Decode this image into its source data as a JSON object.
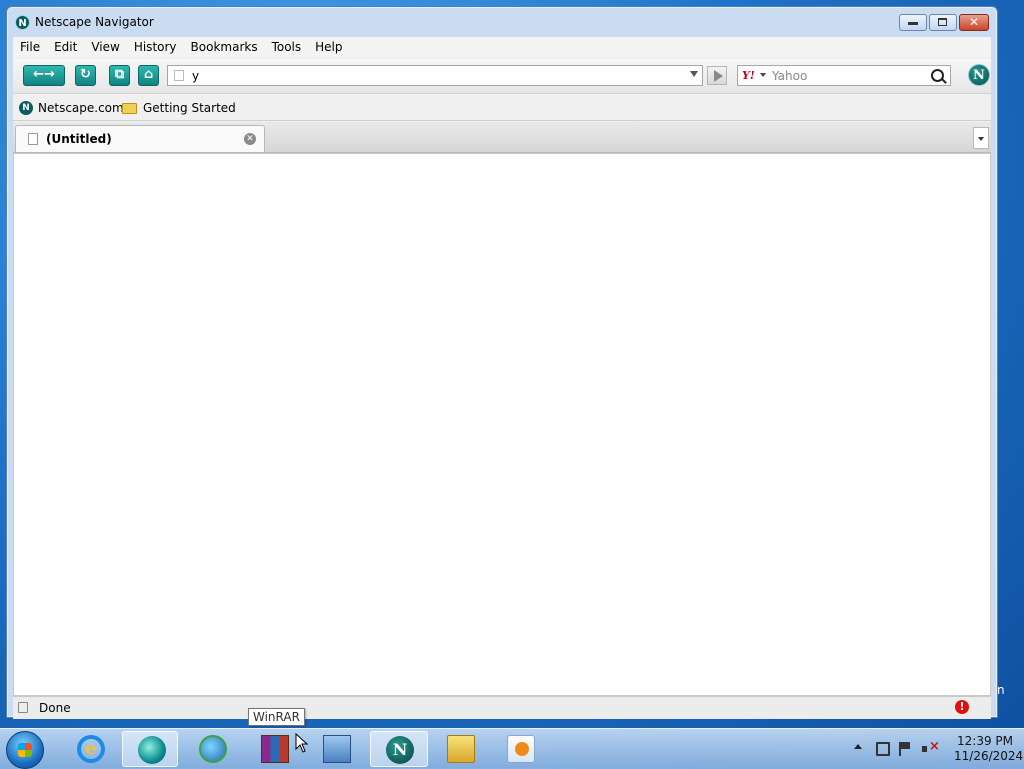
{
  "window": {
    "title": "Netscape Navigator",
    "icon": "netscape-icon",
    "controls": [
      "minimize",
      "maximize",
      "close"
    ]
  },
  "menubar": {
    "items": [
      {
        "label": "File",
        "mnemonic": "F"
      },
      {
        "label": "Edit",
        "mnemonic": "E"
      },
      {
        "label": "View",
        "mnemonic": "V"
      },
      {
        "label": "History",
        "mnemonic": "s"
      },
      {
        "label": "Bookmarks",
        "mnemonic": "B"
      },
      {
        "label": "Tools",
        "mnemonic": "T"
      },
      {
        "label": "Help",
        "mnemonic": "H"
      }
    ]
  },
  "navbar": {
    "buttons": [
      "back-icon",
      "forward-icon",
      "reload-icon",
      "new-tab-icon",
      "home-icon"
    ],
    "url_value": "y",
    "search": {
      "engine": "Yahoo",
      "placeholder": "Yahoo",
      "engine_logo": "Y!"
    },
    "logo": "N"
  },
  "bookmarks": {
    "items": [
      {
        "label": "Netscape.com",
        "icon": "netscape-icon"
      },
      {
        "label": "Getting Started",
        "icon": "folder-icon"
      }
    ]
  },
  "tabs": [
    {
      "label": "(Untitled)",
      "active": true
    }
  ],
  "status": {
    "text": "Done"
  },
  "desktop": {
    "edge_text": "n"
  },
  "taskbar": {
    "tooltip": "WinRAR",
    "apps": [
      "internet-explorer-icon",
      "cyberlink-icon",
      "download-manager-icon",
      "winrar-icon",
      "network-icon",
      "netscape-icon",
      "file-explorer-icon",
      "media-player-icon"
    ],
    "active_app": "netscape-icon",
    "clock": {
      "time": "12:39 PM",
      "date": "11/26/2024"
    }
  },
  "colors": {
    "accent_teal": "#12827f",
    "desktop_blue": "#1f74c9",
    "alert_red": "#e01010"
  }
}
